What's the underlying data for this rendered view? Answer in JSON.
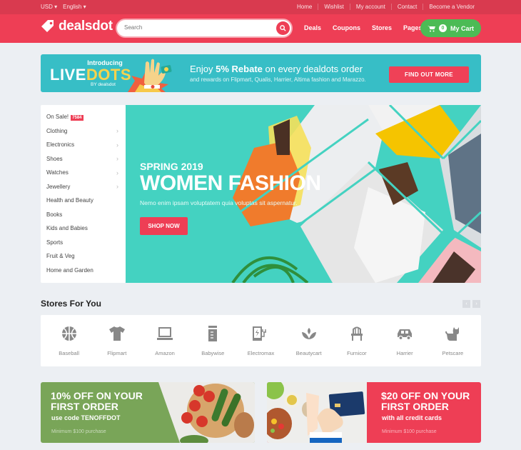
{
  "topbar": {
    "currency": "USD",
    "language": "English",
    "links": [
      "Home",
      "Wishlist",
      "My account",
      "Contact",
      "Become a Vendor"
    ]
  },
  "header": {
    "logo": "dealsdot",
    "search_placeholder": "Search",
    "nav": [
      "Deals",
      "Coupons",
      "Stores",
      "Pages"
    ],
    "cart_count": "0",
    "cart_label": "My Cart"
  },
  "promo": {
    "introducing": "Introducing",
    "brand_part1": "LIVE",
    "brand_part2": "DOTS",
    "by": "BY dealsdot",
    "headline_pre": "Enjoy ",
    "headline_bold": "5% Rebate",
    "headline_post": " on every dealdots order",
    "subline": "and rewards on Flipmart, Qualis, Harrier, Altima fashion and Marazzo.",
    "button": "FIND OUT MORE"
  },
  "sidebar": {
    "items": [
      {
        "label": "On Sale!",
        "badge": "7584",
        "has_sub": false
      },
      {
        "label": "Clothing",
        "has_sub": true
      },
      {
        "label": "Electronics",
        "has_sub": true
      },
      {
        "label": "Shoes",
        "has_sub": true
      },
      {
        "label": "Watches",
        "has_sub": true
      },
      {
        "label": "Jewellery",
        "has_sub": true
      },
      {
        "label": "Health and Beauty",
        "has_sub": false
      },
      {
        "label": "Books",
        "has_sub": false
      },
      {
        "label": "Kids and Babies",
        "has_sub": false
      },
      {
        "label": "Sports",
        "has_sub": false
      },
      {
        "label": "Fruit & Veg",
        "has_sub": false
      },
      {
        "label": "Home and Garden",
        "has_sub": false
      }
    ]
  },
  "hero": {
    "season": "SPRING 2019",
    "title": "WOMEN FASHION",
    "text": "Nemo enim ipsam voluptatem quia voluptas sit aspernatur.",
    "button": "SHOP NOW"
  },
  "stores": {
    "heading": "Stores For You",
    "items": [
      {
        "name": "Baseball",
        "icon": "basketball-icon"
      },
      {
        "name": "Flipmart",
        "icon": "tshirt-icon"
      },
      {
        "name": "Amazon",
        "icon": "laptop-icon"
      },
      {
        "name": "Babywise",
        "icon": "baby-bottle-icon"
      },
      {
        "name": "Electromax",
        "icon": "electric-plug-icon"
      },
      {
        "name": "Beautycart",
        "icon": "lotus-icon"
      },
      {
        "name": "Furnicor",
        "icon": "chair-icon"
      },
      {
        "name": "Harrier",
        "icon": "car-icon"
      },
      {
        "name": "Petscare",
        "icon": "cat-icon"
      }
    ]
  },
  "offers": [
    {
      "title_line1": "10% OFF ON YOUR",
      "title_line2": "FIRST ORDER",
      "sub": "use code TENOFFDOT",
      "min": "Minimum $100 purchase"
    },
    {
      "title_line1": "$20 OFF ON YOUR",
      "title_line2": "FIRST ORDER",
      "sub": "with all credit cards",
      "min": "Minimum $100 purchase"
    }
  ],
  "colors": {
    "brand_red": "#ee3e55",
    "topbar_red": "#d93a4f",
    "cart_green": "#4cbb55",
    "promo_teal": "#37bec6",
    "hero_teal": "#44d2c1",
    "offer_green": "#79a558"
  }
}
